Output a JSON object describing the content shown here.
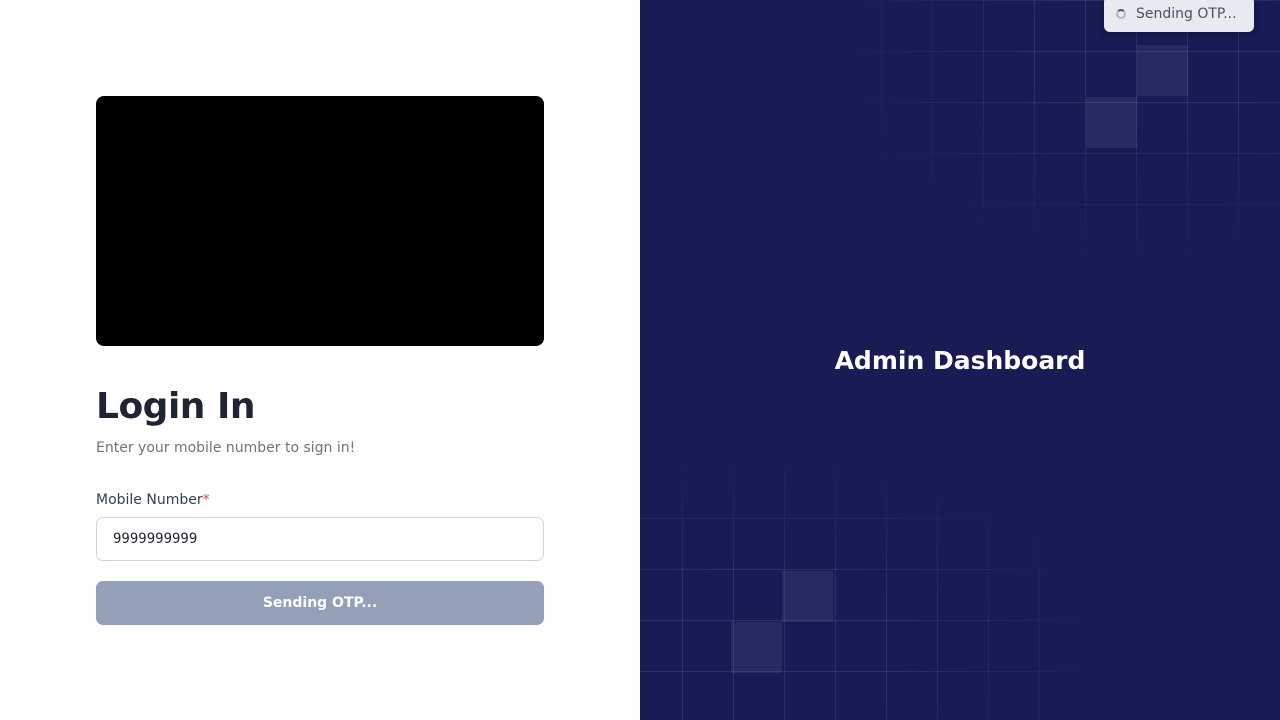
{
  "login": {
    "title": "Login In",
    "subtitle": "Enter your mobile number to sign in!",
    "mobile_label": "Mobile Number",
    "required_mark": "*",
    "mobile_value": "9999999999",
    "submit_label": "Sending OTP..."
  },
  "panel": {
    "title": "Admin Dashboard",
    "background_color": "#181b54"
  },
  "toast": {
    "message": "Sending OTP...",
    "icon": "spinner-icon"
  },
  "colors": {
    "button_disabled": "#94a0b8",
    "required": "#e5484d",
    "heading": "#1e2433"
  }
}
